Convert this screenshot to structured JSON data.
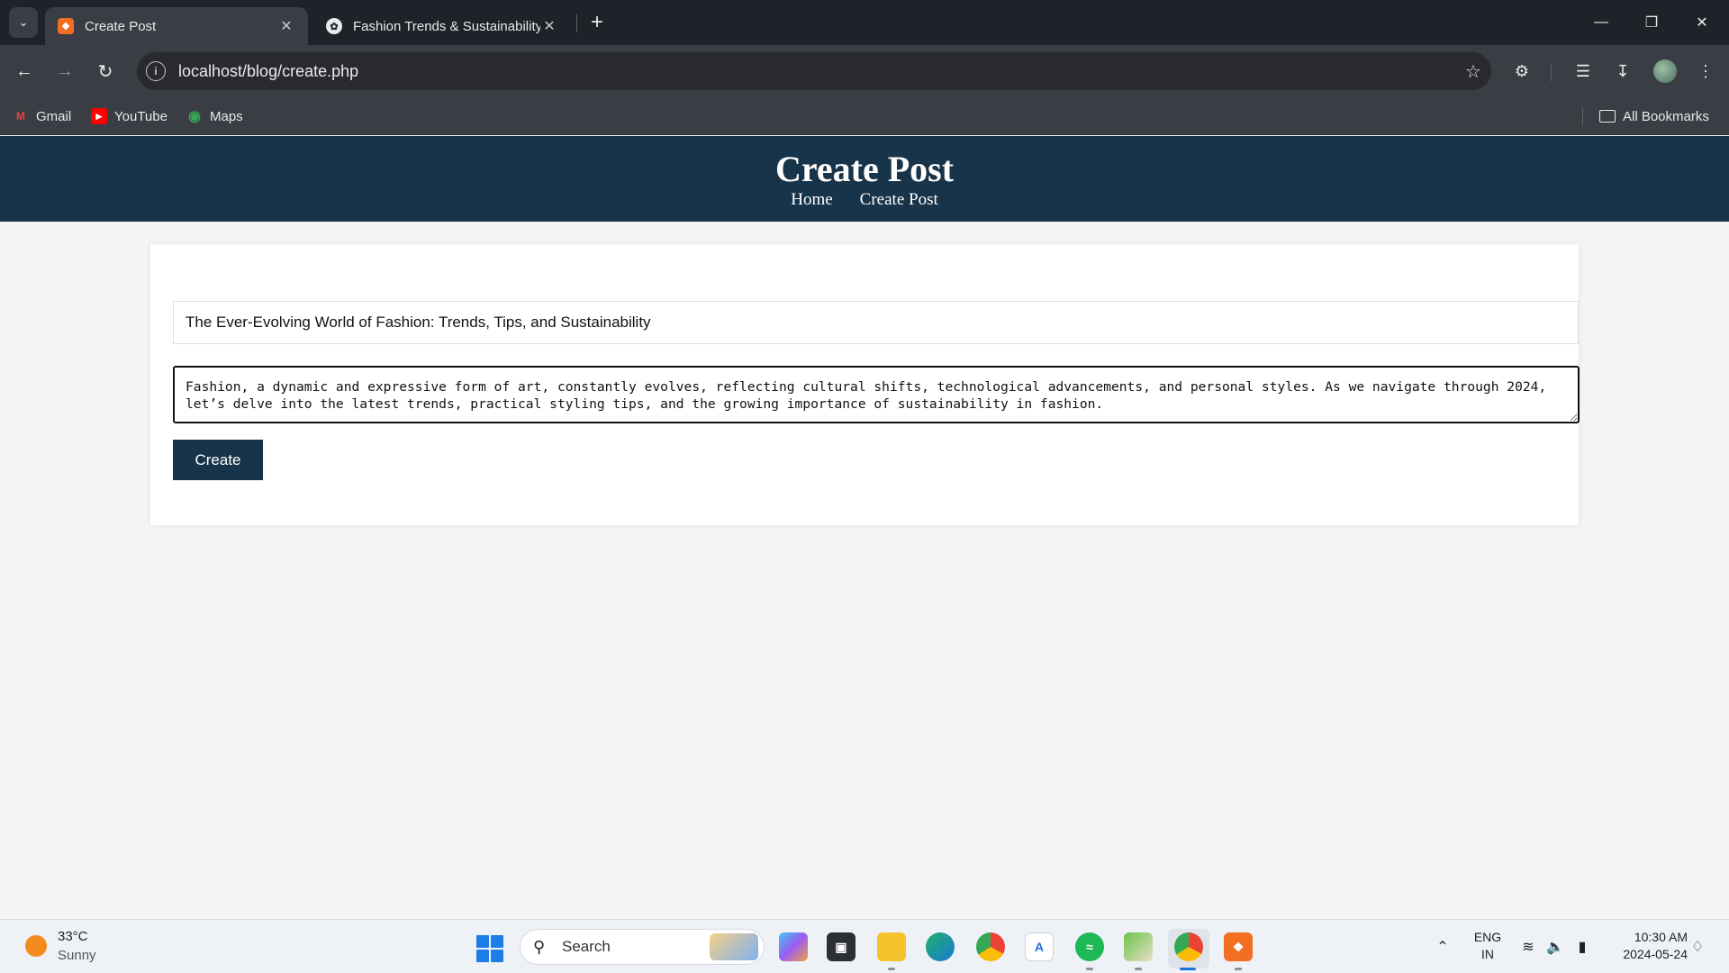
{
  "browser": {
    "tabs": [
      {
        "title": "Create Post",
        "active": true
      },
      {
        "title": "Fashion Trends & Sustainability",
        "active": false
      }
    ],
    "url": "localhost/blog/create.php",
    "bookmarks": [
      {
        "label": "Gmail",
        "icon": "gmail-icon"
      },
      {
        "label": "YouTube",
        "icon": "youtube-icon"
      },
      {
        "label": "Maps",
        "icon": "maps-icon"
      }
    ],
    "all_bookmarks_label": "All Bookmarks"
  },
  "site": {
    "title": "Create Post",
    "nav": [
      "Home",
      "Create Post"
    ]
  },
  "form": {
    "title_value": "The Ever-Evolving World of Fashion: Trends, Tips, and Sustainability",
    "content_value": "Fashion, a dynamic and expressive form of art, constantly evolves, reflecting cultural shifts, technological advancements, and personal styles. As we navigate through 2024, let’s delve into the latest trends, practical styling tips, and the growing importance of sustainability in fashion.",
    "submit_label": "Create"
  },
  "taskbar": {
    "weather_temp": "33°C",
    "weather_desc": "Sunny",
    "search_label": "Search",
    "lang_line1": "ENG",
    "lang_line2": "IN",
    "time": "10:30 AM",
    "date": "2024-05-24"
  },
  "colors": {
    "header_bg": "#18344a",
    "page_bg": "#f4f4f4",
    "button_bg": "#18344a"
  }
}
